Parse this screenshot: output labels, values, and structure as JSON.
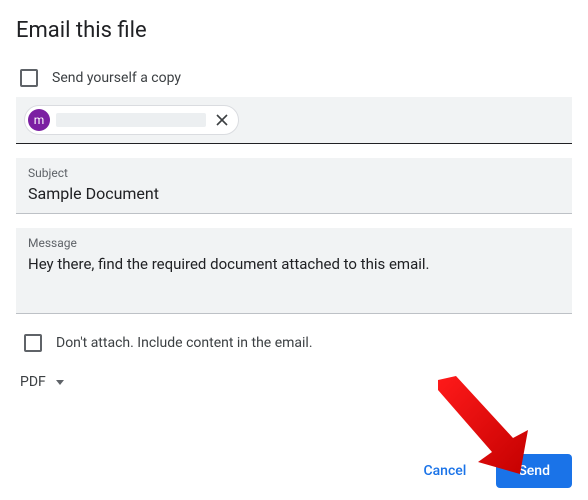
{
  "dialog": {
    "title": "Email this file"
  },
  "sendCopy": {
    "label": "Send yourself a copy",
    "checked": false
  },
  "recipient": {
    "avatar_letter": "m"
  },
  "subject": {
    "label": "Subject",
    "value": "Sample Document"
  },
  "message": {
    "label": "Message",
    "value": "Hey there, find the required document attached to this email."
  },
  "dontAttach": {
    "label": "Don't attach. Include content in the email.",
    "checked": false
  },
  "format": {
    "selected": "PDF"
  },
  "footer": {
    "cancel": "Cancel",
    "send": "Send"
  }
}
